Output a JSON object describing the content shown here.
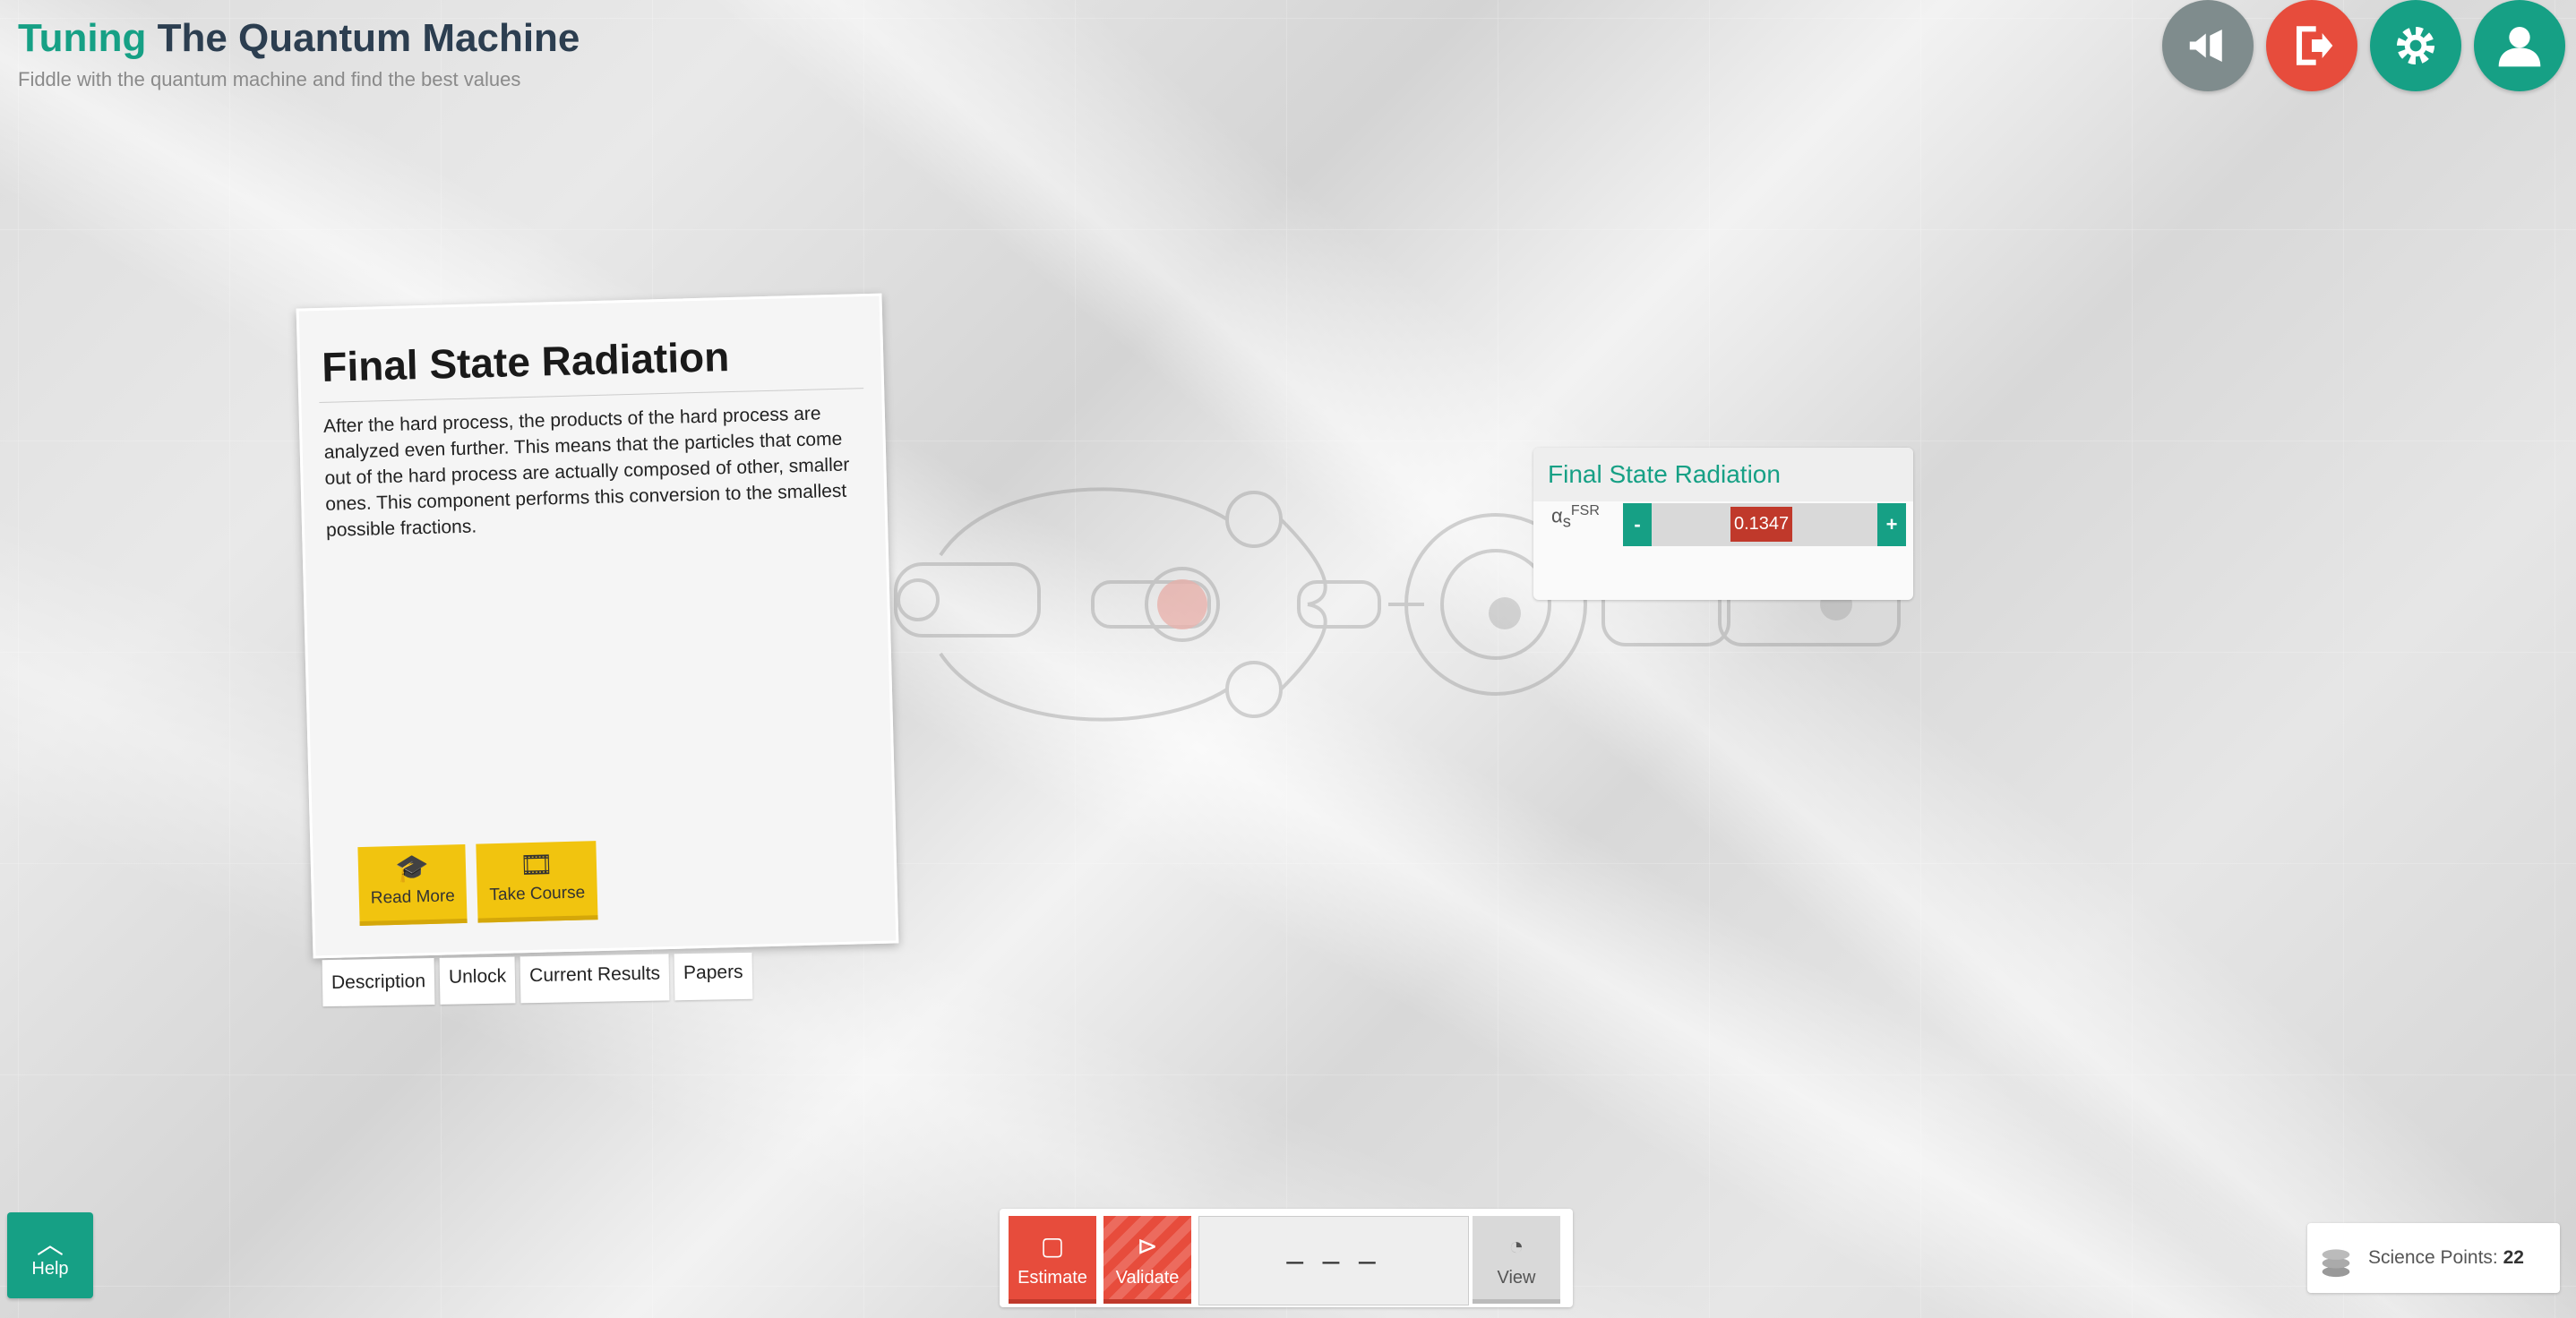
{
  "header": {
    "title_accent": "Tuning",
    "title_main": "The Quantum Machine",
    "subtitle": "Fiddle with the quantum machine and find the best values"
  },
  "top_icons": [
    "megaphone-icon",
    "logout-icon",
    "settings-icon",
    "user-icon"
  ],
  "card": {
    "title": "Final State Radiation",
    "description": "After the hard process, the products of the hard process are analyzed even further. This means that the particles that come out of the hard process are actually composed of other, smaller ones. This component performs this conversion to the smallest possible fractions.",
    "read_more": "Read More",
    "take_course": "Take Course",
    "tabs": [
      "Description",
      "Unlock",
      "Current Results",
      "Papers"
    ]
  },
  "param_panel": {
    "title": "Final State Radiation",
    "param_symbol": "α",
    "param_sub": "s",
    "param_sup": "FSR",
    "minus": "-",
    "plus": "+",
    "value": "0.1347"
  },
  "bottom": {
    "help": "Help",
    "estimate": "Estimate",
    "validate": "Validate",
    "display": "– – –",
    "view": "View"
  },
  "science_points": {
    "label": "Science Points:",
    "value": "22"
  },
  "colors": {
    "accent": "#16a085",
    "danger": "#e74c3c",
    "warning": "#f1c40f"
  }
}
